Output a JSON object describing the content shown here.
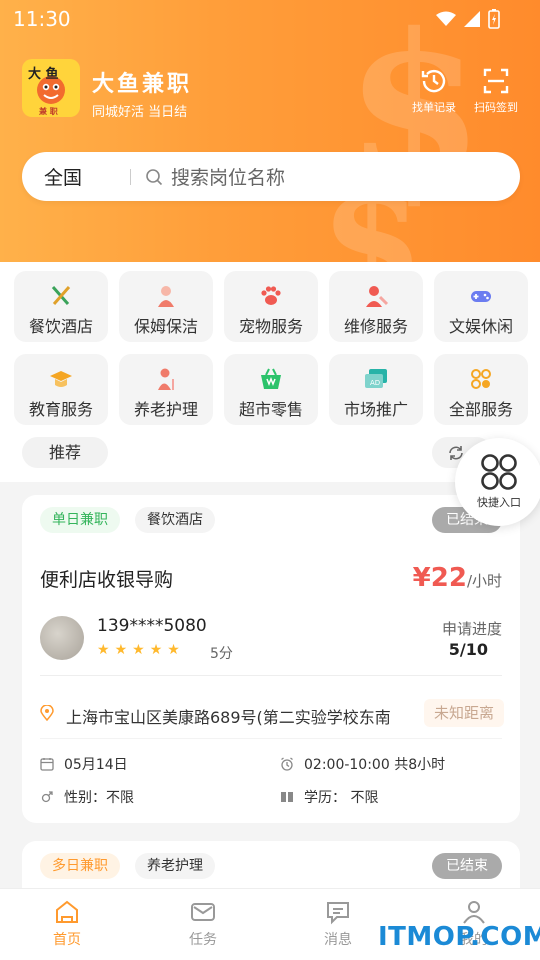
{
  "status_bar": {
    "time": "11:30"
  },
  "app": {
    "name": "大鱼兼职",
    "slogan": "同城好活 当日结",
    "logo_text_top": "大 鱼",
    "logo_text_bottom": "兼 职"
  },
  "header_actions": [
    {
      "label": "找单记录",
      "icon": "history-icon"
    },
    {
      "label": "扫码签到",
      "icon": "scan-icon"
    }
  ],
  "search": {
    "city": "全国",
    "placeholder": "搜索岗位名称"
  },
  "categories": [
    {
      "label": "餐饮酒店",
      "icon": "utensils-icon",
      "color": "#3aa35a"
    },
    {
      "label": "保姆保洁",
      "icon": "nanny-icon",
      "color": "#f07b6a"
    },
    {
      "label": "宠物服务",
      "icon": "paw-icon",
      "color": "#f05a52"
    },
    {
      "label": "维修服务",
      "icon": "wrench-icon",
      "color": "#f05a52"
    },
    {
      "label": "文娱休闲",
      "icon": "gamepad-icon",
      "color": "#6b7cf0"
    },
    {
      "label": "教育服务",
      "icon": "graduation-cap-icon",
      "color": "#f5a623"
    },
    {
      "label": "养老护理",
      "icon": "elderly-icon",
      "color": "#f07b6a"
    },
    {
      "label": "超市零售",
      "icon": "basket-icon",
      "color": "#2cc36b"
    },
    {
      "label": "市场推广",
      "icon": "ad-icon",
      "color": "#27b3a8"
    },
    {
      "label": "全部服务",
      "icon": "grid-icon",
      "color": "#f5a623"
    }
  ],
  "filter": {
    "recommend_label": "推荐"
  },
  "fab": {
    "label": "快捷入口"
  },
  "jobs": [
    {
      "type_tag": "单日兼职",
      "category_tag": "餐饮酒店",
      "status": "已结束",
      "title": "便利店收银导购",
      "price_symbol": "¥",
      "price": "22",
      "price_unit": "/小时",
      "poster": "139****5080",
      "rating_stars": 5,
      "score": "5分",
      "progress_label": "申请进度",
      "progress": "5/10",
      "address": "上海市宝山区美康路689号(第二实验学校东南",
      "distance": "未知距离",
      "date": "05月14日",
      "hours": "02:00-10:00 共8小时",
      "gender": "性别：不限",
      "education": "学历：  不限"
    },
    {
      "type_tag": "多日兼职",
      "category_tag": "养老护理",
      "status": "已结束"
    }
  ],
  "tabbar": [
    {
      "label": "首页",
      "icon": "home-icon",
      "active": true
    },
    {
      "label": "任务",
      "icon": "mail-icon",
      "active": false
    },
    {
      "label": "消息",
      "icon": "message-icon",
      "active": false
    },
    {
      "label": "我的",
      "icon": "user-icon",
      "active": false
    }
  ],
  "watermark": "ITMOP.COM",
  "colors": {
    "brand_orange": "#ff9a2e",
    "price_red": "#f05a52",
    "green_tag": "#34b45b"
  }
}
